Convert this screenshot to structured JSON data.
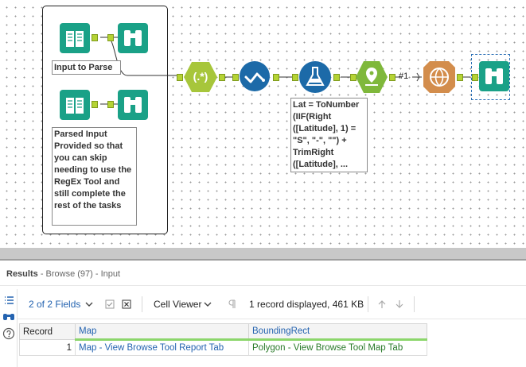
{
  "canvas": {
    "annotations": {
      "input_to_parse": "Input to Parse",
      "parsed_input": "Parsed Input Provided so that you can skip needing to use the RegEx Tool and still complete the rest of the tasks",
      "formula": "Lat = ToNumber (IIF(Right ([Latitude], 1) = \"S\", \"-\", \"\") + TrimRight ([Latitude], ..."
    },
    "regex_label": "(.*)",
    "connection_count": "#1"
  },
  "colors": {
    "input_tool": "#1aa187",
    "browse_tool": "#1aa187",
    "regex_tool": "#a7c63b",
    "select_tool": "#1c6aa8",
    "formula_tool": "#1c6aa8",
    "spatial_tool": "#7fb83b",
    "report_tool": "#d38d4c",
    "connector": "#b5d334",
    "link": "#2463b0",
    "header_underline": "#8cd66b"
  },
  "results": {
    "title": "Results",
    "subtitle": "- Browse (97) - Input"
  },
  "toolbar": {
    "fields_label": "2 of 2 Fields",
    "viewer_label": "Cell Viewer",
    "record_info": "1 record displayed, 461 KB"
  },
  "table": {
    "columns": [
      "Record",
      "Map",
      "BoundingRect"
    ],
    "rows": [
      [
        "1",
        "Map - View Browse Tool Report Tab",
        "Polygon - View Browse Tool Map Tab"
      ]
    ]
  }
}
